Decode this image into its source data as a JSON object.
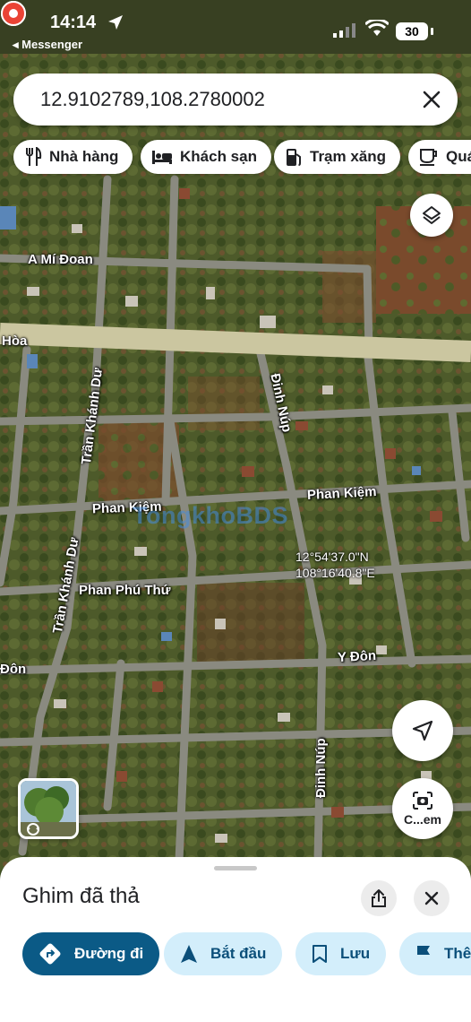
{
  "status_bar": {
    "time": "14:14",
    "back_app": "◂ Messenger",
    "battery": "30"
  },
  "search": {
    "value": "12.9102789,108.2780002"
  },
  "chips": [
    {
      "label": "Nhà hàng",
      "icon": "restaurant-icon"
    },
    {
      "label": "Khách sạn",
      "icon": "hotel-bed-icon"
    },
    {
      "label": "Trạm xăng",
      "icon": "gas-station-icon"
    },
    {
      "label": "Quá",
      "icon": "coffee-cup-icon"
    }
  ],
  "map": {
    "street_labels": {
      "a_mi_doan": "A Mí Đoan",
      "hoa": "Hòa",
      "tran_khanh_du_1": "Trần Khánh Dư",
      "tran_khanh_du_2": "Trần Khánh Dư",
      "dinh_nup_1": "Đinh Núp",
      "dinh_nup_2": "Đinh Núp",
      "phan_kiem_1": "Phan Kiệm",
      "phan_kiem_2": "Phan Kiệm",
      "phan_phu_thu": "Phan Phú Thứ",
      "y_don": "Y Đôn",
      "don": "Đôn"
    },
    "watermark": "TongkhoBDS",
    "pin": {
      "lat": "12°54'37.0\"N",
      "lng": "108°16'40.8\"E",
      "color": "#ea4335"
    },
    "camera_label": "C...em"
  },
  "sheet": {
    "title": "Ghim đã thả",
    "actions": [
      {
        "label": "Đường đi",
        "icon": "directions-icon"
      },
      {
        "label": "Bắt đầu",
        "icon": "navigation-arrow-icon"
      },
      {
        "label": "Lưu",
        "icon": "bookmark-icon"
      },
      {
        "label": "Thê",
        "icon": "flag-icon"
      }
    ]
  }
}
